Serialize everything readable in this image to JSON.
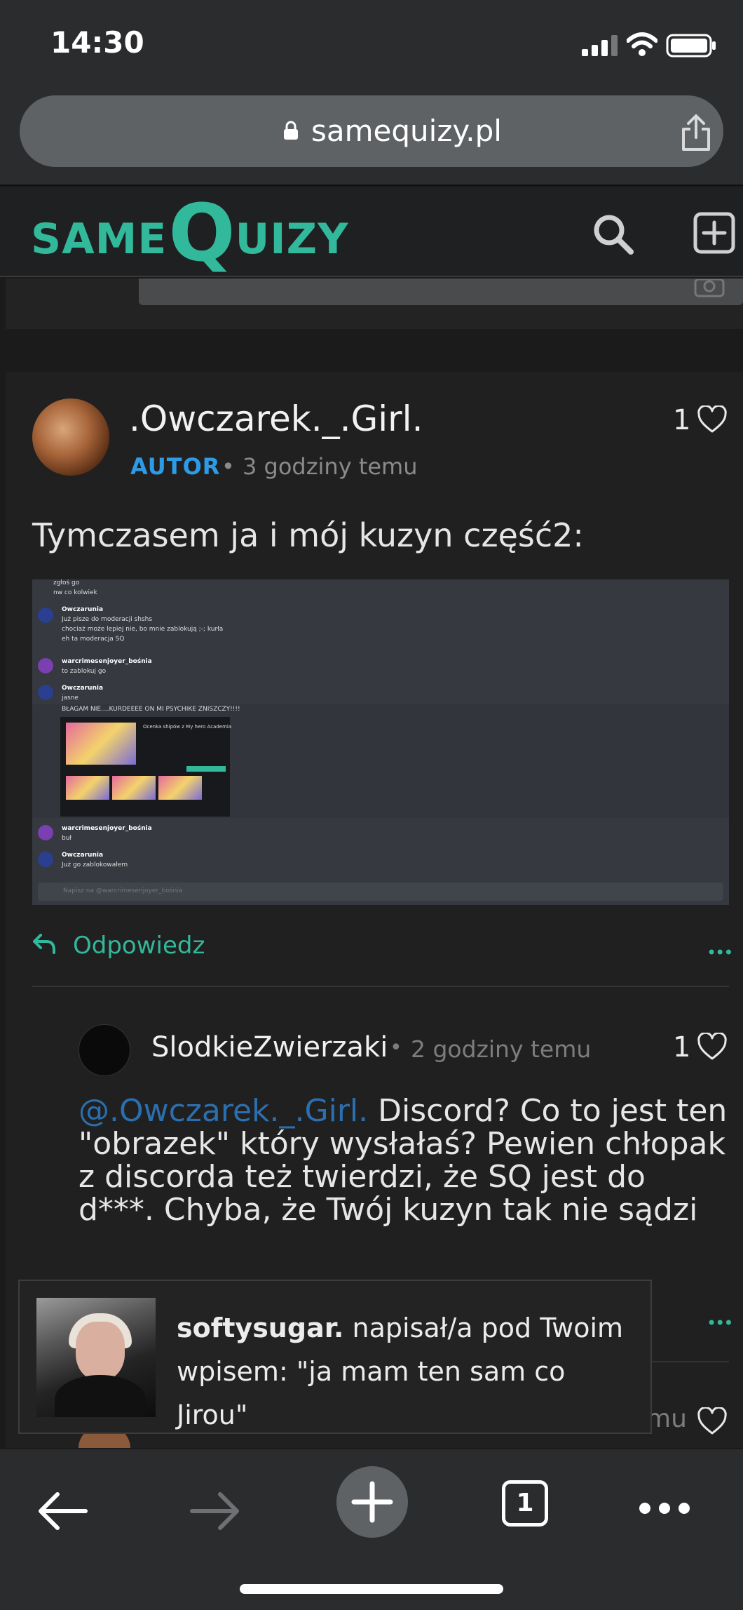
{
  "status_bar": {
    "time": "14:30"
  },
  "browser": {
    "url": "samequizy.pl",
    "tab_count": "1"
  },
  "site": {
    "logo": {
      "part1": "SAME",
      "part2": "Q",
      "part3": "UIZY"
    }
  },
  "post": {
    "author": ".Owczarek._.Girl.",
    "badge": "AUTOR",
    "separator": "•",
    "time": "3 godziny temu",
    "likes": "1",
    "text": "Tymczasem ja i mój kuzyn część2:",
    "reply_label": "Odpowiedz",
    "more": "•••",
    "screenshot": {
      "lines": [
        "zgłoś go",
        "nw co kolwiek",
        "Owczarunia",
        "Już pisze do moderacji shshs",
        "chociaż może lepiej nie, bo mnie zablokują ;-; kurła",
        "eh ta moderacja SQ",
        "warcrimesenjoyer_bośnia",
        "to zablokuj go",
        "Owczarunia",
        "jasne",
        "BŁAGAM NIE....KURDEEEE ON MI PSYCHIKE ZNISZCZY!!!!",
        "Ocenka shipów z My hero Academia",
        "warcrimesenjoyer_bośnia",
        "buł",
        "Owczarunia",
        "Już go zablokowałem",
        "Napisz na @warcrimesenjoyer_bośnia"
      ]
    }
  },
  "comment": {
    "author": "SlodkieZwierzaki",
    "separator": "•",
    "time": "2 godziny temu",
    "likes": "1",
    "mention": "@.Owczarek._.Girl.",
    "text": " Discord? Co to jest ten \"obrazek\" który wysłałaś? Pewien chłopak z discorda też twierdzi, że SQ jest do d***. Chyba, że Twój kuzyn tak nie sądzi",
    "more": "•••"
  },
  "next_comment": {
    "time_tail": "mu"
  },
  "toast": {
    "user": "softysugar.",
    "text": " napisał/a pod Twoim wpisem: \"ja mam ten sam co Jirou\""
  },
  "colors": {
    "accent": "#32b89a",
    "badge": "#2d9be6",
    "mention": "#2b6fb0",
    "background": "#1b1b1b"
  }
}
